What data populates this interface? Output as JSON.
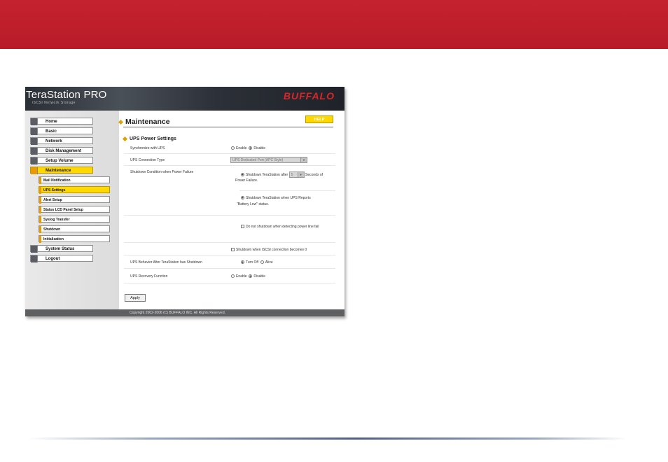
{
  "app": {
    "logo_title": "TeraStation PRO",
    "logo_subtitle": "iSCSI Network Storage",
    "brand": "BUFFALO"
  },
  "sidebar": {
    "items": [
      {
        "label": "Home",
        "icon": "home-icon"
      },
      {
        "label": "Basic",
        "icon": "basic-icon"
      },
      {
        "label": "Network",
        "icon": "network-icon"
      },
      {
        "label": "Disk Management",
        "icon": "disk-icon"
      },
      {
        "label": "Setup Volume",
        "icon": "volume-icon"
      },
      {
        "label": "Maintenance",
        "icon": "tools-icon",
        "active": true
      },
      {
        "label": "System Status",
        "icon": "status-icon"
      },
      {
        "label": "Logout",
        "icon": "logout-icon"
      }
    ],
    "subitems": [
      {
        "label": "Mail Notification"
      },
      {
        "label": "UPS Settings",
        "active": true
      },
      {
        "label": "Alert Setup"
      },
      {
        "label": "Status LCD Panel Setup"
      },
      {
        "label": "Syslog Transfer"
      },
      {
        "label": "Shutdown"
      },
      {
        "label": "Initialization"
      }
    ]
  },
  "main": {
    "title": "Maintenance",
    "help_label": "HELP",
    "section_title": "UPS Power Settings",
    "sync_label": "Synchronize with UPS",
    "sync_enable": "Enable",
    "sync_disable": "Disable",
    "conn_type_label": "UPS Connection Type",
    "conn_type_value": "UPS Dedicated Port (APC Style)",
    "shutdown_cond_label": "Shutdown Condition when Power Failure",
    "opt1_before": "Shutdown TeraStation after",
    "opt1_seconds": "5",
    "opt1_after": "Seconds of",
    "opt1_line2": "Power Failure.",
    "opt2_line1": "Shutdown TeraStation when UPS Reports",
    "opt2_line2": "\"Battery Low\" status.",
    "opt3": "Do not shutdown when detecting power line fail",
    "iscsi_option": "Shutdown when iSCSI connection becomes 0",
    "behavior_label": "UPS Behavior After TeraStation has Shutdown",
    "behavior_off": "Turn Off",
    "behavior_alive": "Alive",
    "recovery_label": "UPS Recovery Function",
    "recovery_enable": "Enable",
    "recovery_disable": "Disable",
    "apply_label": "Apply"
  },
  "footer": {
    "copyright": "Copyright 2002-2006 (C) BUFFALO INC. All Rights Reserved."
  },
  "colors": {
    "top_bar": "#c4222e",
    "nav_active": "#ffd800",
    "accent_orange": "#e89a00",
    "brand_red": "#d8262a"
  }
}
